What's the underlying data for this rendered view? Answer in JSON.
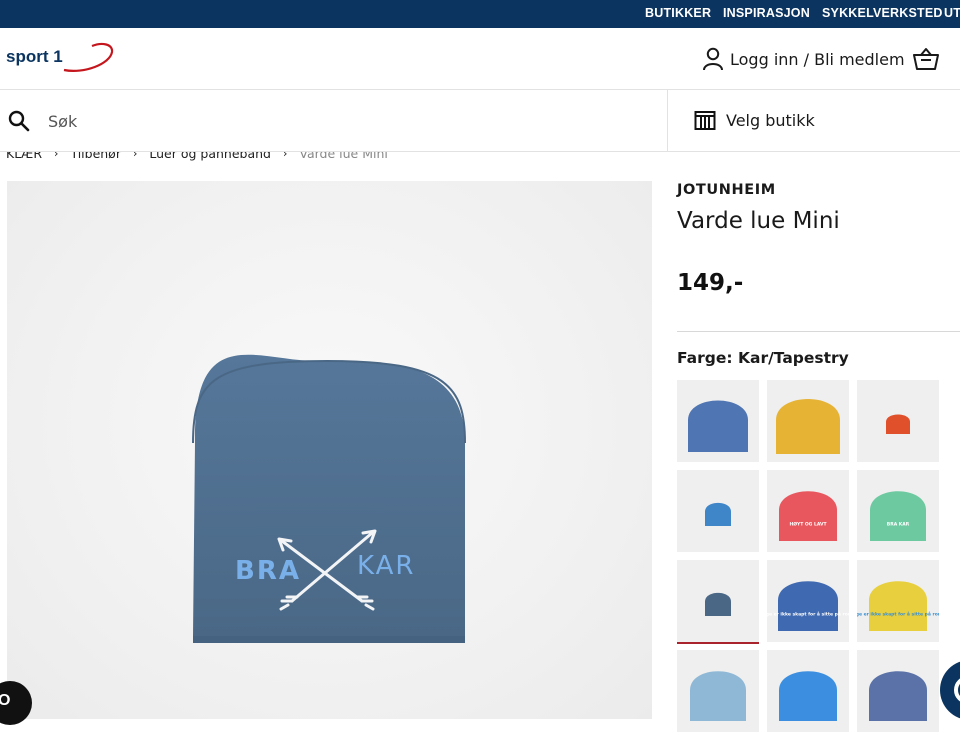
{
  "topnav": {
    "items": [
      "BUTIKKER",
      "INSPIRASJON",
      "SYKKELVERKSTED",
      "UT"
    ]
  },
  "header": {
    "logo_text": "sport 1",
    "login_label": "Logg inn / Bli medlem"
  },
  "search": {
    "placeholder": "Søk"
  },
  "store": {
    "label": "Velg butikk"
  },
  "breadcrumb": {
    "items": [
      "KLÆR",
      "Tilbehør",
      "Luer og pannebånd"
    ],
    "current": "Varde lue Mini"
  },
  "product": {
    "brand": "JOTUNHEIM",
    "title": "Varde lue Mini",
    "price": "149,-",
    "color_label": "Farge: Kar/Tapestry",
    "print_left": "BRA",
    "print_right": "KAR"
  },
  "swatches": [
    {
      "color": "#4f75b3",
      "print": "",
      "selected": false
    },
    {
      "color": "#e6b335",
      "print": "",
      "selected": false
    },
    {
      "color": "#e0502b",
      "print": "",
      "selected": false
    },
    {
      "color": "#3f86c9",
      "print": "",
      "selected": false
    },
    {
      "color": "#e8575e",
      "print": "HØYT OG LAVT",
      "selected": false
    },
    {
      "color": "#6cc9a0",
      "print": "BRA KAR",
      "selected": false
    },
    {
      "color": "#4a6786",
      "print": "",
      "selected": true
    },
    {
      "color": "#3f69b0",
      "print": "norge er ikke skapt for å sitte på rompa",
      "selected": false
    },
    {
      "color": "#e8cf3d",
      "print": "norge er ikke skapt for å sitte på rompa",
      "selected": false
    },
    {
      "color": "#8fb8d6",
      "print": "",
      "selected": false
    },
    {
      "color": "#3c8fe0",
      "print": "",
      "selected": false
    },
    {
      "color": "#5a72a8",
      "print": "",
      "selected": false
    }
  ],
  "floating": {
    "left_button_text": "O"
  },
  "colors": {
    "topbar": "#0b3560",
    "selected_underline": "#a8232c",
    "hat_main": "#4f6f8e"
  }
}
